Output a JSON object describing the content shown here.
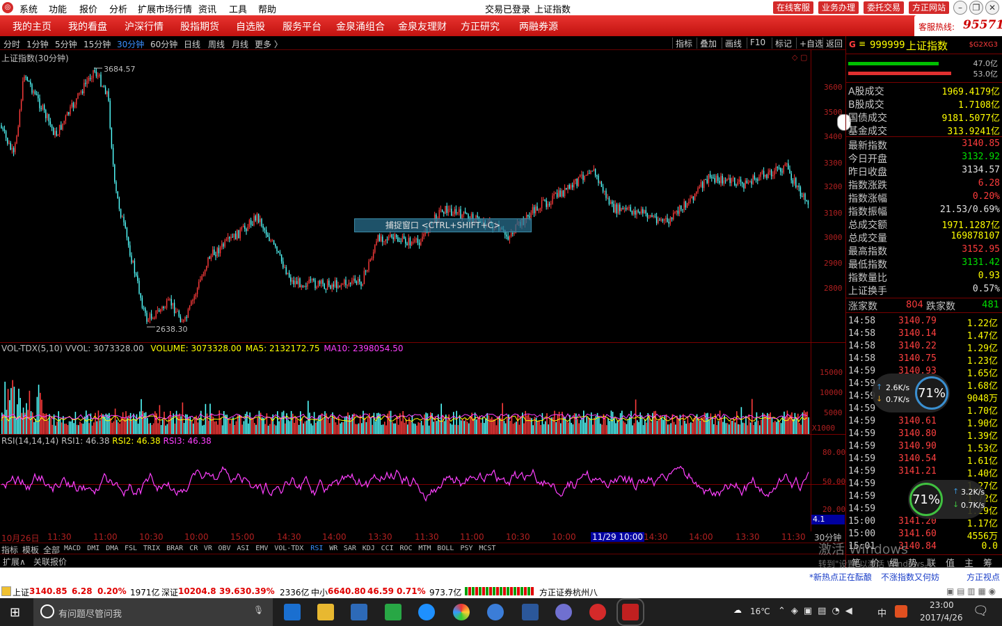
{
  "titlebar": {
    "menus": [
      "系统",
      "功能",
      "报价",
      "分析",
      "扩展市场行情",
      "资讯",
      "工具",
      "帮助"
    ],
    "status": "交易已登录",
    "index_name": "上证指数",
    "buttons": [
      "在线客服",
      "业务办理",
      "委托交易",
      "方正网站"
    ]
  },
  "navbar": {
    "items": [
      "我的主页",
      "我的看盘",
      "沪深行情",
      "股指期货",
      "自选股",
      "服务平台",
      "金泉涌组合",
      "金泉友理财",
      "方正研究",
      "两融券源"
    ],
    "hotline_label": "客服热线:",
    "hotline_number": "95571"
  },
  "periods": {
    "items": [
      "分时",
      "1分钟",
      "5分钟",
      "15分钟",
      "30分钟",
      "60分钟",
      "日线",
      "周线",
      "月线",
      "更多 〉"
    ],
    "active": "30分钟",
    "tools": [
      "指标",
      "叠加",
      "画线",
      "F10",
      "标记",
      "+自选",
      "返回"
    ]
  },
  "main_chart": {
    "title": "上证指数(30分钟)",
    "high_label": "3684.57",
    "low_label": "2638.30",
    "y_ticks": [
      "3600",
      "3500",
      "3400",
      "3300",
      "3200",
      "3100",
      "3000",
      "2900",
      "2800"
    ],
    "tooltip": "捕捉窗口 <CTRL+SHIFT+C>"
  },
  "volume_chart": {
    "title": "VOL-TDX(5,10)",
    "vvol": "VVOL: 3073328.00",
    "volume": "VOLUME: 3073328.00",
    "ma5": "MA5: 2132172.75",
    "ma10": "MA10: 2398054.50",
    "y_ticks": [
      "15000",
      "10000",
      "5000"
    ],
    "unit": "X1000"
  },
  "rsi_chart": {
    "title": "RSI(14,14,14)",
    "rsi1": "RSI1: 46.38",
    "rsi2": "RSI2: 46.38",
    "rsi3": "RSI3: 46.38",
    "y_ticks": [
      "80.00",
      "50.00",
      "20.00"
    ],
    "flag": "4.1"
  },
  "x_axis": {
    "labels": [
      "10月26日",
      "11:30",
      "11:00",
      "10:30",
      "10:00",
      "15:00",
      "14:30",
      "14:00",
      "13:30",
      "11:30",
      "11:00",
      "10:30",
      "10:00",
      "11/29 10:00",
      "14:30",
      "14:00",
      "13:30",
      "11:30"
    ],
    "period": "30分钟"
  },
  "indicator_tabs": [
    "指标",
    "模板",
    "全部",
    "MACD",
    "DMI",
    "DMA",
    "FSL",
    "TRIX",
    "BRAR",
    "CR",
    "VR",
    "OBV",
    "ASI",
    "EMV",
    "VOL-TDX",
    "RSI",
    "WR",
    "SAR",
    "KDJ",
    "CCI",
    "ROC",
    "MTM",
    "BOLL",
    "PSY",
    "MCST"
  ],
  "ext_tabs": [
    "扩展∧",
    "关联报价"
  ],
  "right_panel": {
    "code": "999999",
    "name": "上证指数",
    "tag": "$G2XG3",
    "up_pct": "47.0亿",
    "down_pct": "53.0亿",
    "volumes": [
      {
        "k": "A股成交",
        "v": "1969.4179亿"
      },
      {
        "k": "B股成交",
        "v": "1.7108亿"
      },
      {
        "k": "国债成交",
        "v": "9181.5077亿"
      },
      {
        "k": "基金成交",
        "v": "313.9241亿"
      }
    ],
    "stats": [
      {
        "k": "最新指数",
        "v": "3140.85",
        "c": "red"
      },
      {
        "k": "今日开盘",
        "v": "3132.92",
        "c": "green"
      },
      {
        "k": "昨日收盘",
        "v": "3134.57",
        "c": "wht"
      },
      {
        "k": "指数涨跌",
        "v": "6.28",
        "c": "red"
      },
      {
        "k": "指数涨幅",
        "v": "0.20%",
        "c": "red"
      },
      {
        "k": "指数振幅",
        "v": "21.53/0.69%",
        "c": "wht"
      },
      {
        "k": "总成交额",
        "v": "1971.1287亿",
        "c": "yel"
      },
      {
        "k": "总成交量",
        "v": "169878107",
        "c": "yel"
      },
      {
        "k": "最高指数",
        "v": "3152.95",
        "c": "red"
      },
      {
        "k": "最低指数",
        "v": "3131.42",
        "c": "green"
      },
      {
        "k": "指数量比",
        "v": "0.93",
        "c": "yel"
      },
      {
        "k": "上证换手",
        "v": "0.57%",
        "c": "wht"
      }
    ],
    "up_label": "涨家数",
    "up_count": "804",
    "down_label": "跌家数",
    "down_count": "481",
    "ticks": [
      {
        "t": "14:58",
        "p": "3140.79",
        "q": "1.22亿"
      },
      {
        "t": "14:58",
        "p": "3140.14",
        "q": "1.47亿"
      },
      {
        "t": "14:58",
        "p": "3140.22",
        "q": "1.29亿"
      },
      {
        "t": "14:58",
        "p": "3140.75",
        "q": "1.23亿"
      },
      {
        "t": "14:59",
        "p": "3140.93",
        "q": "1.65亿"
      },
      {
        "t": "14:59",
        "p": "",
        "q": "1.68亿"
      },
      {
        "t": "14:59",
        "p": "",
        "q": "9048万"
      },
      {
        "t": "14:59",
        "p": "",
        "q": "1.70亿"
      },
      {
        "t": "14:59",
        "p": "3140.61",
        "q": "1.90亿"
      },
      {
        "t": "14:59",
        "p": "3140.80",
        "q": "1.39亿"
      },
      {
        "t": "14:59",
        "p": "3140.90",
        "q": "1.53亿"
      },
      {
        "t": "14:59",
        "p": "3140.54",
        "q": "1.61亿"
      },
      {
        "t": "14:59",
        "p": "3141.21",
        "q": "1.40亿"
      },
      {
        "t": "14:59",
        "p": "",
        "q": "1.27亿"
      },
      {
        "t": "14:59",
        "p": "",
        "q": "1.72亿"
      },
      {
        "t": "14:59",
        "p": "",
        "q": "1.29亿"
      },
      {
        "t": "15:00",
        "p": "3141.20",
        "q": "1.17亿"
      },
      {
        "t": "15:00",
        "p": "3141.60",
        "q": "4556万"
      },
      {
        "t": "15:01",
        "p": "3140.84",
        "q": "0.0"
      }
    ],
    "bottom_tabs": [
      "笔",
      "价",
      "细",
      "势",
      "联",
      "值",
      "主",
      "筹"
    ]
  },
  "speed_widget_1": {
    "up": "2.6K/s",
    "down": "0.7K/s",
    "pct": "71%"
  },
  "speed_widget_2": {
    "up": "3.2K/s",
    "down": "0.7K/s",
    "pct": "71%"
  },
  "activate_windows": {
    "title": "激活 Windows",
    "sub": "转到\"设置\"以激活 Windows。"
  },
  "newsbar": {
    "items": [
      "*新热点正在酝酿",
      "不涨指数又何妨",
      "方正视点"
    ]
  },
  "statusbar": {
    "sh_label": "上证",
    "sh_val": "3140.85",
    "sh_chg": "6.28",
    "sh_pct": "0.20%",
    "sh_amt": "1971亿",
    "sz_label": "深证",
    "sz_val": "10204.8",
    "sz_chg": "39.63",
    "sz_pct": "0.39%",
    "sz_amt": "2336亿",
    "zx_label": "中小",
    "zx_val": "6640.80",
    "zx_chg": "46.59",
    "zx_pct": "0.71%",
    "zx_amt": "973.7亿",
    "broker": "方正证券杭州八"
  },
  "taskbar": {
    "search_placeholder": "有问题尽管问我",
    "weather": "16℃",
    "ime": "中",
    "time": "23:00",
    "date": "2017/4/26"
  },
  "colors": {
    "up": "#ff3c3c",
    "down": "#00e0e0",
    "ma": "#ffff00",
    "rsi": "#ff40ff",
    "grid": "#7a0000",
    "nav": "#d42a2a"
  }
}
